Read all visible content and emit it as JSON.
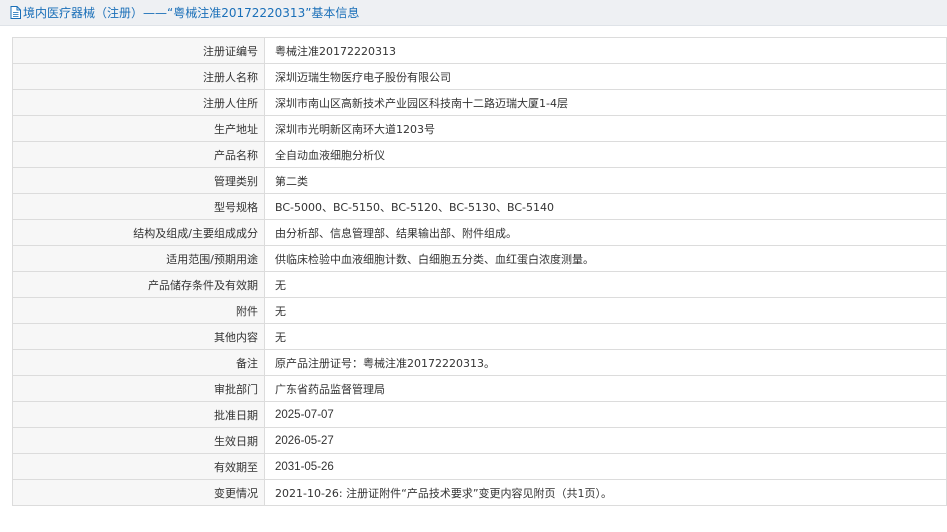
{
  "header": {
    "title": "境内医疗器械（注册）——“粤械注准20172220313”基本信息",
    "icon": "document-icon",
    "color": "#1a6fb8"
  },
  "rows": [
    {
      "label": "注册证编号",
      "value": "粤械注准20172220313"
    },
    {
      "label": "注册人名称",
      "value": "深圳迈瑞生物医疗电子股份有限公司"
    },
    {
      "label": "注册人住所",
      "value": "深圳市南山区高新技术产业园区科技南十二路迈瑞大厦1-4层"
    },
    {
      "label": "生产地址",
      "value": "深圳市光明新区南环大道1203号"
    },
    {
      "label": "产品名称",
      "value": "全自动血液细胞分析仪"
    },
    {
      "label": "管理类别",
      "value": "第二类"
    },
    {
      "label": "型号规格",
      "value": "BC-5000、BC-5150、BC-5120、BC-5130、BC-5140"
    },
    {
      "label": "结构及组成/主要组成成分",
      "value": "由分析部、信息管理部、结果输出部、附件组成。"
    },
    {
      "label": "适用范围/预期用途",
      "value": "供临床检验中血液细胞计数、白细胞五分类、血红蛋白浓度测量。"
    },
    {
      "label": "产品储存条件及有效期",
      "value": "无"
    },
    {
      "label": "附件",
      "value": "无"
    },
    {
      "label": "其他内容",
      "value": "无"
    },
    {
      "label": "备注",
      "value": "原产品注册证号：粤械注准20172220313。"
    },
    {
      "label": "审批部门",
      "value": "广东省药品监督管理局"
    },
    {
      "label": "批准日期",
      "value": "2025-07-07"
    },
    {
      "label": "生效日期",
      "value": "2026-05-27"
    },
    {
      "label": "有效期至",
      "value": "2031-05-26"
    },
    {
      "label": "变更情况",
      "value": "2021-10-26: 注册证附件“产品技术要求”变更内容见附页（共1页）。"
    }
  ]
}
